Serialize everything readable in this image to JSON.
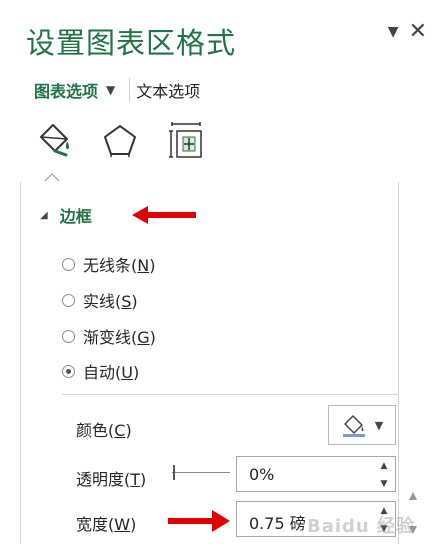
{
  "pane": {
    "title": "设置图表区格式",
    "dropdown_icon": "triangle-down",
    "close_icon": "close-x"
  },
  "tabs": {
    "chart_options": "图表选项",
    "text_options": "文本选项"
  },
  "icons": [
    "fill-line-icon",
    "effects-pentagon-icon",
    "size-properties-icon"
  ],
  "section": {
    "label": "边框"
  },
  "radios": [
    {
      "label": "无线条",
      "key": "N",
      "checked": false
    },
    {
      "label": "实线",
      "key": "S",
      "checked": false
    },
    {
      "label": "渐变线",
      "key": "G",
      "checked": false
    },
    {
      "label": "自动",
      "key": "U",
      "checked": true
    }
  ],
  "color": {
    "label": "颜色",
    "key": "C"
  },
  "transparency": {
    "label": "透明度",
    "key": "T",
    "value": "0%",
    "slider_fraction": 0
  },
  "width": {
    "label": "宽度",
    "key": "W",
    "value": "0.75 磅"
  },
  "colors": {
    "accent": "#217346",
    "annotation_red": "#e00000"
  },
  "watermark": "Baidu 经验"
}
